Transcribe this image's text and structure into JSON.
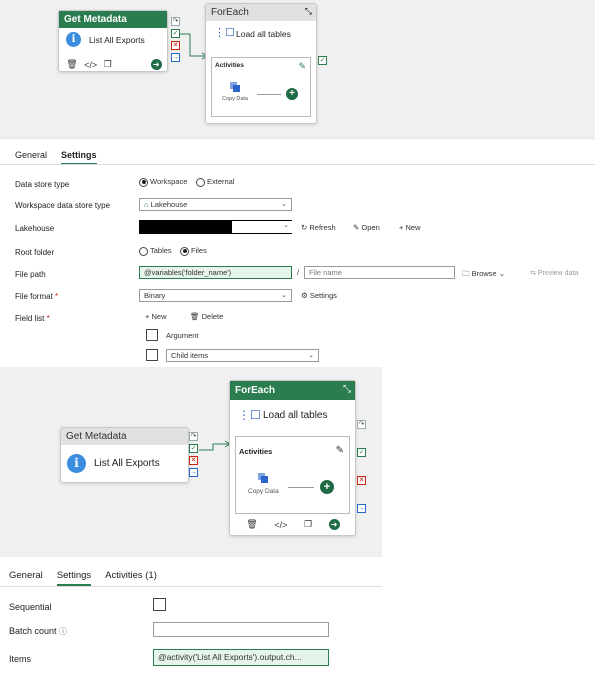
{
  "top": {
    "get_metadata": {
      "title": "Get Metadata",
      "activity": "List All Exports"
    },
    "foreach": {
      "title": "ForEach",
      "task": "Load all tables",
      "activities_label": "Activities",
      "inner_activity": "Copy Data"
    },
    "tabs": [
      "General",
      "Settings"
    ],
    "active_tab": "Settings",
    "form": {
      "data_store_type": {
        "label": "Data store type",
        "options": [
          "Workspace",
          "External"
        ],
        "selected": "Workspace"
      },
      "workspace_data_store_type": {
        "label": "Workspace data store type",
        "value": "Lakehouse"
      },
      "lakehouse": {
        "label": "Lakehouse",
        "actions": [
          "Refresh",
          "Open",
          "New"
        ]
      },
      "root_folder": {
        "label": "Root folder",
        "options": [
          "Tables",
          "Files"
        ],
        "selected": "Files"
      },
      "file_path": {
        "label": "File path",
        "value": "@variables('folder_name')",
        "separator": "/",
        "file_name_placeholder": "File name",
        "browse": "Browse",
        "preview": "Preview data"
      },
      "file_format": {
        "label": "File format",
        "required": "*",
        "value": "Binary",
        "settings": "Settings"
      },
      "field_list": {
        "label": "Field list",
        "required": "*",
        "new": "New",
        "delete": "Delete",
        "items": [
          "Argument",
          "Child items"
        ]
      }
    }
  },
  "bottom": {
    "get_metadata": {
      "title": "Get Metadata",
      "activity": "List All Exports"
    },
    "foreach": {
      "title": "ForEach",
      "task": "Load all tables",
      "activities_label": "Activities",
      "inner_activity": "Copy Data"
    },
    "tabs": [
      "General",
      "Settings",
      "Activities (1)"
    ],
    "active_tab": "Settings",
    "form": {
      "sequential": {
        "label": "Sequential"
      },
      "batch_count": {
        "label": "Batch count",
        "info": "ⓘ"
      },
      "items": {
        "label": "Items",
        "value": "@activity('List All Exports').output.ch..."
      }
    }
  },
  "colors": {
    "accent_green": "#2b7d4f",
    "info_blue": "#3b8de0",
    "error_red": "#cc2211"
  }
}
